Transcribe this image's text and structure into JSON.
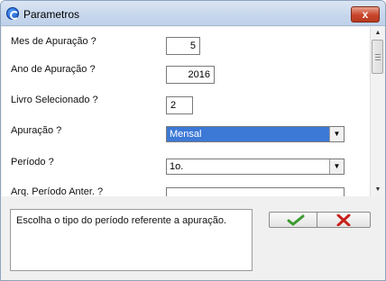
{
  "window": {
    "title": "Parametros",
    "close_glyph": "x"
  },
  "form": {
    "fields": [
      {
        "label": "Mes de Apuração ?",
        "value": "5"
      },
      {
        "label": "Ano de Apuração ?",
        "value": "2016"
      },
      {
        "label": "Livro Selecionado ?",
        "value": "2"
      },
      {
        "label": "Apuração ?",
        "value": "Mensal"
      },
      {
        "label": "Período ?",
        "value": "1o."
      },
      {
        "label": "Arq. Período Anter. ?",
        "value": ""
      }
    ]
  },
  "help": {
    "text": "Escolha o tipo do período referente a apuração."
  },
  "buttons": {
    "ok_icon": "checkmark-icon",
    "cancel_icon": "x-icon",
    "ok_color": "#3a9a2e",
    "cancel_color": "#c8201b"
  },
  "colors": {
    "selected_highlight": "#3c79d6",
    "title_gradient": "#c6d6ec"
  }
}
